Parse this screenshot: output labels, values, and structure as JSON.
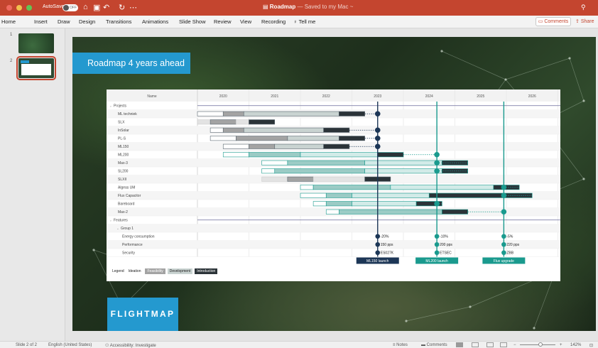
{
  "titlebar": {
    "autosave_label": "AutoSave",
    "autosave_state": "OFF",
    "doc_title": "Roadmap",
    "doc_status": "— Saved to my Mac ~"
  },
  "ribbon": {
    "tabs": [
      "Home",
      "Insert",
      "Draw",
      "Design",
      "Transitions",
      "Animations",
      "Slide Show",
      "Review",
      "View",
      "Recording"
    ],
    "tell_me": "Tell me",
    "comments": "Comments",
    "share": "Share"
  },
  "thumbnails": {
    "nums": [
      "1",
      "2"
    ]
  },
  "slide": {
    "title": "Roadmap 4 years ahead",
    "logo": "FLIGHTMAP"
  },
  "roadmap": {
    "name_header": "Name",
    "years": [
      "2020",
      "2021",
      "2022",
      "2023",
      "2024",
      "2025",
      "2026"
    ],
    "start_year": 2019.5,
    "colors": {
      "ideation": "#ffffff",
      "feasibility": "#a3a3a3",
      "development": "#c9d3d1",
      "introduction": "#2b3338",
      "teal": "#1a9a8e",
      "navy": "#1c3656",
      "row_stripe": "#f5f5f5"
    },
    "rows": [
      {
        "name": "Projects",
        "type": "header"
      },
      {
        "name": "ML techniek",
        "theme": "grey",
        "segs": [
          [
            2019.5,
            2020,
            "i"
          ],
          [
            2020,
            2020.4,
            "f"
          ],
          [
            2020.4,
            2022.25,
            "d"
          ],
          [
            2022.25,
            2022.75,
            "n"
          ]
        ],
        "dot": "navy"
      },
      {
        "name": "SLX",
        "theme": "grey",
        "segs": [
          [
            2019.5,
            2019.75,
            "l"
          ],
          [
            2019.75,
            2020.25,
            "f"
          ],
          [
            2020.25,
            2020.5,
            "l"
          ],
          [
            2020.5,
            2021,
            "n"
          ]
        ]
      },
      {
        "name": "InSolar",
        "theme": "grey",
        "segs": [
          [
            2019.75,
            2020,
            "i"
          ],
          [
            2020,
            2020.4,
            "f"
          ],
          [
            2020.4,
            2021.95,
            "d"
          ],
          [
            2021.95,
            2022.45,
            "n"
          ]
        ],
        "dot": "navy"
      },
      {
        "name": "PL-S",
        "theme": "grey",
        "segs": [
          [
            2019.75,
            2020.25,
            "i"
          ],
          [
            2020.25,
            2021.25,
            "f"
          ],
          [
            2021.25,
            2022.25,
            "d"
          ],
          [
            2022.25,
            2022.75,
            "n"
          ]
        ],
        "dot": "navy"
      },
      {
        "name": "ML150",
        "theme": "grey",
        "segs": [
          [
            2020,
            2020.5,
            "i"
          ],
          [
            2020.5,
            2021,
            "f"
          ],
          [
            2021,
            2021.95,
            "d"
          ],
          [
            2021.95,
            2022.45,
            "n"
          ]
        ],
        "dot": "navy"
      },
      {
        "name": "ML200",
        "theme": "teal",
        "segs": [
          [
            2020,
            2020.5,
            "i"
          ],
          [
            2020.5,
            2021.5,
            "f"
          ],
          [
            2021.5,
            2023,
            "d"
          ],
          [
            2023,
            2023.5,
            "n"
          ]
        ],
        "dot": "teal"
      },
      {
        "name": "Max-3",
        "theme": "teal",
        "segs": [
          [
            2020.75,
            2021.25,
            "i"
          ],
          [
            2021.25,
            2022.75,
            "f"
          ],
          [
            2022.75,
            2024.25,
            "d"
          ],
          [
            2024.25,
            2024.75,
            "n"
          ]
        ],
        "dot": "teal"
      },
      {
        "name": "SL200",
        "theme": "teal",
        "segs": [
          [
            2020.75,
            2021,
            "i"
          ],
          [
            2021,
            2022.75,
            "f"
          ],
          [
            2022.75,
            2024.25,
            "d"
          ],
          [
            2024.25,
            2024.75,
            "n"
          ]
        ],
        "dot": "teal"
      },
      {
        "name": "SLXII",
        "theme": "grey",
        "segs": [
          [
            2020.75,
            2021.25,
            "l"
          ],
          [
            2021.25,
            2021.75,
            "f"
          ],
          [
            2021.75,
            2022.75,
            "l"
          ],
          [
            2022.75,
            2023.25,
            "n"
          ]
        ]
      },
      {
        "name": "Algeas UM",
        "theme": "teal",
        "segs": [
          [
            2021.5,
            2021.75,
            "i"
          ],
          [
            2021.75,
            2023.25,
            "f"
          ],
          [
            2023.25,
            2025.25,
            "d"
          ],
          [
            2025.25,
            2025.75,
            "n"
          ]
        ],
        "dot": "teal"
      },
      {
        "name": "Flux Capacitor",
        "theme": "teal",
        "segs": [
          [
            2021.5,
            2022,
            "i"
          ],
          [
            2022,
            2022.5,
            "f"
          ],
          [
            2022.5,
            2024,
            "d"
          ],
          [
            2024,
            2026,
            "n"
          ]
        ],
        "dot": "teal"
      },
      {
        "name": "Bareboard",
        "theme": "teal",
        "segs": [
          [
            2021.75,
            2022,
            "i"
          ],
          [
            2022,
            2022.5,
            "f"
          ],
          [
            2022.5,
            2023.75,
            "d"
          ],
          [
            2023.75,
            2024.25,
            "n"
          ]
        ],
        "dot": "teal"
      },
      {
        "name": "Max-2",
        "theme": "teal",
        "segs": [
          [
            2022,
            2022.25,
            "i"
          ],
          [
            2022.25,
            2024.25,
            "f"
          ],
          [
            2024.25,
            2024.75,
            "n"
          ]
        ],
        "dot": "teal"
      },
      {
        "name": "Features",
        "type": "header"
      },
      {
        "name": "Group 1",
        "type": "subheader"
      },
      {
        "name": "Energy consumption",
        "values": [
          "-20%",
          "-10%",
          "-5%"
        ]
      },
      {
        "name": "Performance",
        "values": [
          "150 pps",
          "200 pps",
          "220 pps"
        ]
      },
      {
        "name": "Security",
        "values": [
          "ES027K",
          "ETSEC",
          "ZBB"
        ]
      }
    ],
    "milestones": [
      {
        "date": 2023,
        "label": "ML150 launch",
        "color": "navy"
      },
      {
        "date": 2024.15,
        "label": "ML200 launch",
        "color": "teal"
      },
      {
        "date": 2025.45,
        "label": "Flux upgrade",
        "color": "teal"
      }
    ],
    "legend": {
      "title": "Legend",
      "items": [
        {
          "label": "Ideation",
          "color": "#ffffff"
        },
        {
          "label": "Feasibility",
          "color": "#a3a3a3"
        },
        {
          "label": "Development",
          "color": "#c9d3d1"
        },
        {
          "label": "Introduction",
          "color": "#2b3338"
        }
      ]
    }
  },
  "status": {
    "slide_of": "Slide 2 of 2",
    "language": "English (United States)",
    "accessibility": "Accessibility: Investigate",
    "notes": "Notes",
    "comments": "Comments",
    "zoom": "142%"
  }
}
